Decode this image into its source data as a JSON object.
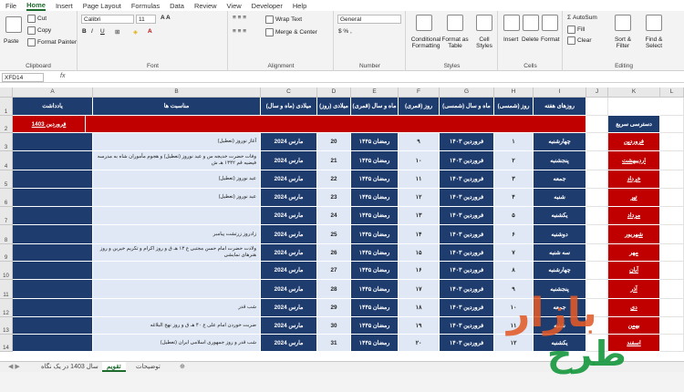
{
  "menu": [
    "File",
    "Home",
    "Insert",
    "Page Layout",
    "Formulas",
    "Data",
    "Review",
    "View",
    "Developer",
    "Help"
  ],
  "menu_active": "Home",
  "ribbon": {
    "clipboard": {
      "paste": "Paste",
      "cut": "Cut",
      "copy": "Copy",
      "painter": "Format Painter",
      "label": "Clipboard"
    },
    "font": {
      "name": "Calibri",
      "size": "11",
      "label": "Font"
    },
    "alignment": {
      "wrap": "Wrap Text",
      "merge": "Merge & Center",
      "label": "Alignment"
    },
    "number": {
      "format": "General",
      "label": "Number"
    },
    "styles": {
      "cond": "Conditional Formatting",
      "table": "Format as Table",
      "cell": "Cell Styles",
      "label": "Styles"
    },
    "cells": {
      "insert": "Insert",
      "delete": "Delete",
      "format": "Format",
      "label": "Cells"
    },
    "editing": {
      "autosum": "AutoSum",
      "fill": "Fill",
      "clear": "Clear",
      "sort": "Sort & Filter",
      "find": "Find & Select",
      "label": "Editing"
    }
  },
  "namebox": "XFD14",
  "fx": "fx",
  "columns": [
    "A",
    "B",
    "C",
    "D",
    "E",
    "F",
    "G",
    "H",
    "I",
    "J",
    "K",
    "L"
  ],
  "rows": [
    "1",
    "2",
    "3",
    "4",
    "5",
    "6",
    "7",
    "8",
    "9",
    "10",
    "11",
    "12",
    "13",
    "14"
  ],
  "headers": {
    "notes": "یادداشت",
    "occasions": "مناسبت ها",
    "greg_my": "میلادی (ماه و سال)",
    "greg_day": "میلادی (روز)",
    "hijri_my": "ماه و سال (قمری)",
    "hijri_day": "روز (قمری)",
    "shamsi_my": "ماه و سال (شمسی)",
    "shamsi_day": "روز (شمسی)",
    "weekday": "روزهای هفته"
  },
  "month_title": "فروردین 1403",
  "table": [
    {
      "occ": "آغاز نوروز (تعطیل)",
      "gm": "مارس 2024",
      "gd": "20",
      "hm": "رمضان ۱۴۴۵",
      "hd": "۹",
      "sm": "فروردین ۱۴۰۳",
      "sd": "۱",
      "wd": "چهارشنبه"
    },
    {
      "occ": "وفات حضرت خدیجه س و عید نوروز (تعطیل) و هجوم مأموران شاه به مدرسه فیضیه قم ۱۳۴۲ هـ ش",
      "gm": "مارس 2024",
      "gd": "21",
      "hm": "رمضان ۱۴۴۵",
      "hd": "۱۰",
      "sm": "فروردین ۱۴۰۳",
      "sd": "۲",
      "wd": "پنجشنبه"
    },
    {
      "occ": "عید نوروز (تعطیل)",
      "gm": "مارس 2024",
      "gd": "22",
      "hm": "رمضان ۱۴۴۵",
      "hd": "۱۱",
      "sm": "فروردین ۱۴۰۳",
      "sd": "۳",
      "wd": "جمعه"
    },
    {
      "occ": "عید نوروز (تعطیل)",
      "gm": "مارس 2024",
      "gd": "23",
      "hm": "رمضان ۱۴۴۵",
      "hd": "۱۲",
      "sm": "فروردین ۱۴۰۳",
      "sd": "۴",
      "wd": "شنبه"
    },
    {
      "occ": "",
      "gm": "مارس 2024",
      "gd": "24",
      "hm": "رمضان ۱۴۴۵",
      "hd": "۱۳",
      "sm": "فروردین ۱۴۰۳",
      "sd": "۵",
      "wd": "یکشنبه"
    },
    {
      "occ": "زادروز زرتشت پیامبر",
      "gm": "مارس 2024",
      "gd": "25",
      "hm": "رمضان ۱۴۴۵",
      "hd": "۱۴",
      "sm": "فروردین ۱۴۰۳",
      "sd": "۶",
      "wd": "دوشنبه"
    },
    {
      "occ": "ولادت حضرت امام حسن مجتبی ع ۱۳ هـ ق و روز اکرام و تکریم خیرین و روز هنرهای نمایشی",
      "gm": "مارس 2024",
      "gd": "26",
      "hm": "رمضان ۱۴۴۵",
      "hd": "۱۵",
      "sm": "فروردین ۱۴۰۳",
      "sd": "۷",
      "wd": "سه شنبه"
    },
    {
      "occ": "",
      "gm": "مارس 2024",
      "gd": "27",
      "hm": "رمضان ۱۴۴۵",
      "hd": "۱۶",
      "sm": "فروردین ۱۴۰۳",
      "sd": "۸",
      "wd": "چهارشنبه"
    },
    {
      "occ": "",
      "gm": "مارس 2024",
      "gd": "28",
      "hm": "رمضان ۱۴۴۵",
      "hd": "۱۷",
      "sm": "فروردین ۱۴۰۳",
      "sd": "۹",
      "wd": "پنجشنبه"
    },
    {
      "occ": "شب قدر",
      "gm": "مارس 2024",
      "gd": "29",
      "hm": "رمضان ۱۴۴۵",
      "hd": "۱۸",
      "sm": "فروردین ۱۴۰۳",
      "sd": "۱۰",
      "wd": "جمعه"
    },
    {
      "occ": "ضربت خوردن امام علی ع ۴۰ هـ ق و روز نهج البلاغه",
      "gm": "مارس 2024",
      "gd": "30",
      "hm": "رمضان ۱۴۴۵",
      "hd": "۱۹",
      "sm": "فروردین ۱۴۰۳",
      "sd": "۱۱",
      "wd": "شنبه"
    },
    {
      "occ": "شب قدر و روز جمهوری اسلامی ایران (تعطیل)",
      "gm": "مارس 2024",
      "gd": "31",
      "hm": "رمضان ۱۴۴۵",
      "hd": "۲۰",
      "sm": "فروردین ۱۴۰۳",
      "sd": "۱۲",
      "wd": "یکشنبه"
    }
  ],
  "quick": {
    "title": "دسترسی سریع",
    "months": [
      "فروردین",
      "اردیبهشت",
      "خرداد",
      "تیر",
      "مرداد",
      "شهریور",
      "مهر",
      "آبان",
      "آذر",
      "دی",
      "بهمن",
      "اسفند"
    ]
  },
  "sheets": [
    "سال 1403 در یک نگاه",
    "تقویم",
    "توضیحات"
  ],
  "sheet_active": "تقویم",
  "watermark": {
    "line1": "بازار",
    "line2": "طرح"
  },
  "colors": {
    "navy": "#1f3c6e",
    "light": "#dfe8f4",
    "red": "#c00000",
    "accent": "#1e6b2e"
  }
}
